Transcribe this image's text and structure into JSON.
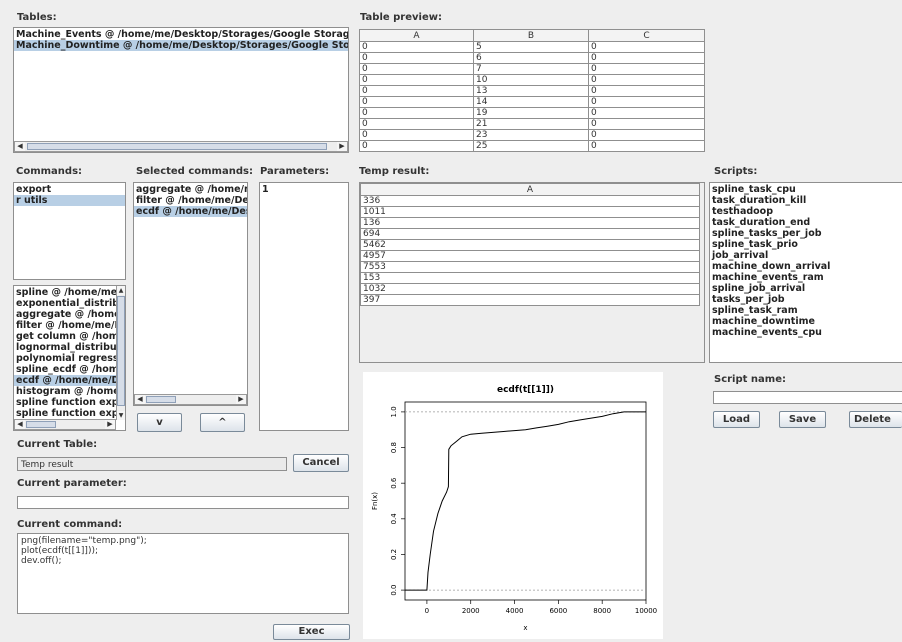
{
  "labels": {
    "tables": "Tables:",
    "table_preview": "Table preview:",
    "commands": "Commands:",
    "selected_commands": "Selected commands:",
    "parameters": "Parameters:",
    "temp_result": "Temp result:",
    "scripts": "Scripts:",
    "script_name": "Script name:",
    "current_table": "Current Table:",
    "current_parameter": "Current parameter:",
    "current_command": "Current command:"
  },
  "tables": [
    {
      "text": "Machine_Events @ /home/me/Desktop/Storages/Google Storage @ SQLite",
      "selected": false
    },
    {
      "text": "Machine_Downtime @ /home/me/Desktop/Storages/Google Storage @ SQLite",
      "selected": true
    }
  ],
  "preview": {
    "headers": [
      "A",
      "B",
      "C"
    ],
    "rows": [
      [
        "0",
        "5",
        "0"
      ],
      [
        "0",
        "6",
        "0"
      ],
      [
        "0",
        "7",
        "0"
      ],
      [
        "0",
        "10",
        "0"
      ],
      [
        "0",
        "13",
        "0"
      ],
      [
        "0",
        "14",
        "0"
      ],
      [
        "0",
        "19",
        "0"
      ],
      [
        "0",
        "21",
        "0"
      ],
      [
        "0",
        "23",
        "0"
      ],
      [
        "0",
        "25",
        "0"
      ]
    ]
  },
  "commands": [
    {
      "text": "export",
      "selected": false
    },
    {
      "text": "r utils",
      "selected": true
    }
  ],
  "functions": [
    {
      "text": "spline @ /home/me/Desktop",
      "selected": false
    },
    {
      "text": "exponential_distribution",
      "selected": false
    },
    {
      "text": "aggregate @ /home/me/Desktop",
      "selected": false
    },
    {
      "text": "filter @ /home/me/Desktop",
      "selected": false
    },
    {
      "text": "get column @ /home/me/Desktop",
      "selected": false
    },
    {
      "text": "lognormal_distribution",
      "selected": false
    },
    {
      "text": "polynomial regression",
      "selected": false
    },
    {
      "text": "spline_ecdf @ /home/me/Desktop",
      "selected": false
    },
    {
      "text": "ecdf @ /home/me/Desktop",
      "selected": true
    },
    {
      "text": "histogram @ /home/me/Desktop",
      "selected": false
    },
    {
      "text": "spline function export",
      "selected": false
    },
    {
      "text": "spline function export",
      "selected": false
    }
  ],
  "selected_commands": [
    {
      "text": "aggregate @ /home/me/Desktop",
      "selected": false
    },
    {
      "text": "filter @ /home/me/Desktop",
      "selected": false
    },
    {
      "text": "ecdf @ /home/me/Desktop",
      "selected": true
    }
  ],
  "parameters": [
    "1"
  ],
  "move_down_label": "v",
  "move_up_label": "^",
  "temp_result": {
    "headers": [
      "A"
    ],
    "rows": [
      "336",
      "1011",
      "136",
      "694",
      "5462",
      "4957",
      "7553",
      "153",
      "1032",
      "397"
    ]
  },
  "scripts": [
    "spline_task_cpu",
    "task_duration_kill",
    "testhadoop",
    "task_duration_end",
    "spline_tasks_per_job",
    "spline_task_prio",
    "job_arrival",
    "machine_down_arrival",
    "machine_events_ram",
    "spline_job_arrival",
    "tasks_per_job",
    "spline_task_ram",
    "machine_downtime",
    "machine_events_cpu"
  ],
  "script_name_value": "",
  "buttons": {
    "load": "Load",
    "save": "Save",
    "delete": "Delete",
    "cancel": "Cancel",
    "exec": "Exec"
  },
  "current_table_value": "Temp result",
  "current_parameter_value": "",
  "current_command_value": "png(filename=\"temp.png\");\nplot(ecdf(t[[1]]));\ndev.off();",
  "chart_data": {
    "type": "line",
    "title": "ecdf(t[[1]])",
    "xlabel": "x",
    "ylabel": "Fn(x)",
    "xlim": [
      -1000,
      10000
    ],
    "ylim": [
      0,
      1
    ],
    "xticks": [
      "0",
      "2000",
      "4000",
      "6000",
      "8000",
      "10000"
    ],
    "yticks": [
      "0.0",
      "0.2",
      "0.4",
      "0.6",
      "0.8",
      "1.0"
    ],
    "grid": false,
    "reference_lines": [
      0,
      1
    ],
    "series": [
      {
        "x": [
          -1000,
          0,
          50,
          150,
          300,
          500,
          700,
          900,
          980,
          1000,
          1100,
          1300,
          1600,
          2000,
          2500,
          3000,
          3500,
          4000,
          4500,
          5000,
          5500,
          6000,
          6500,
          7000,
          7500,
          8000,
          8500,
          9000,
          10000
        ],
        "values": [
          0,
          0,
          0.1,
          0.2,
          0.33,
          0.43,
          0.5,
          0.55,
          0.58,
          0.79,
          0.81,
          0.83,
          0.86,
          0.875,
          0.88,
          0.885,
          0.89,
          0.895,
          0.9,
          0.91,
          0.92,
          0.93,
          0.945,
          0.955,
          0.965,
          0.975,
          0.99,
          1,
          1
        ]
      }
    ]
  }
}
